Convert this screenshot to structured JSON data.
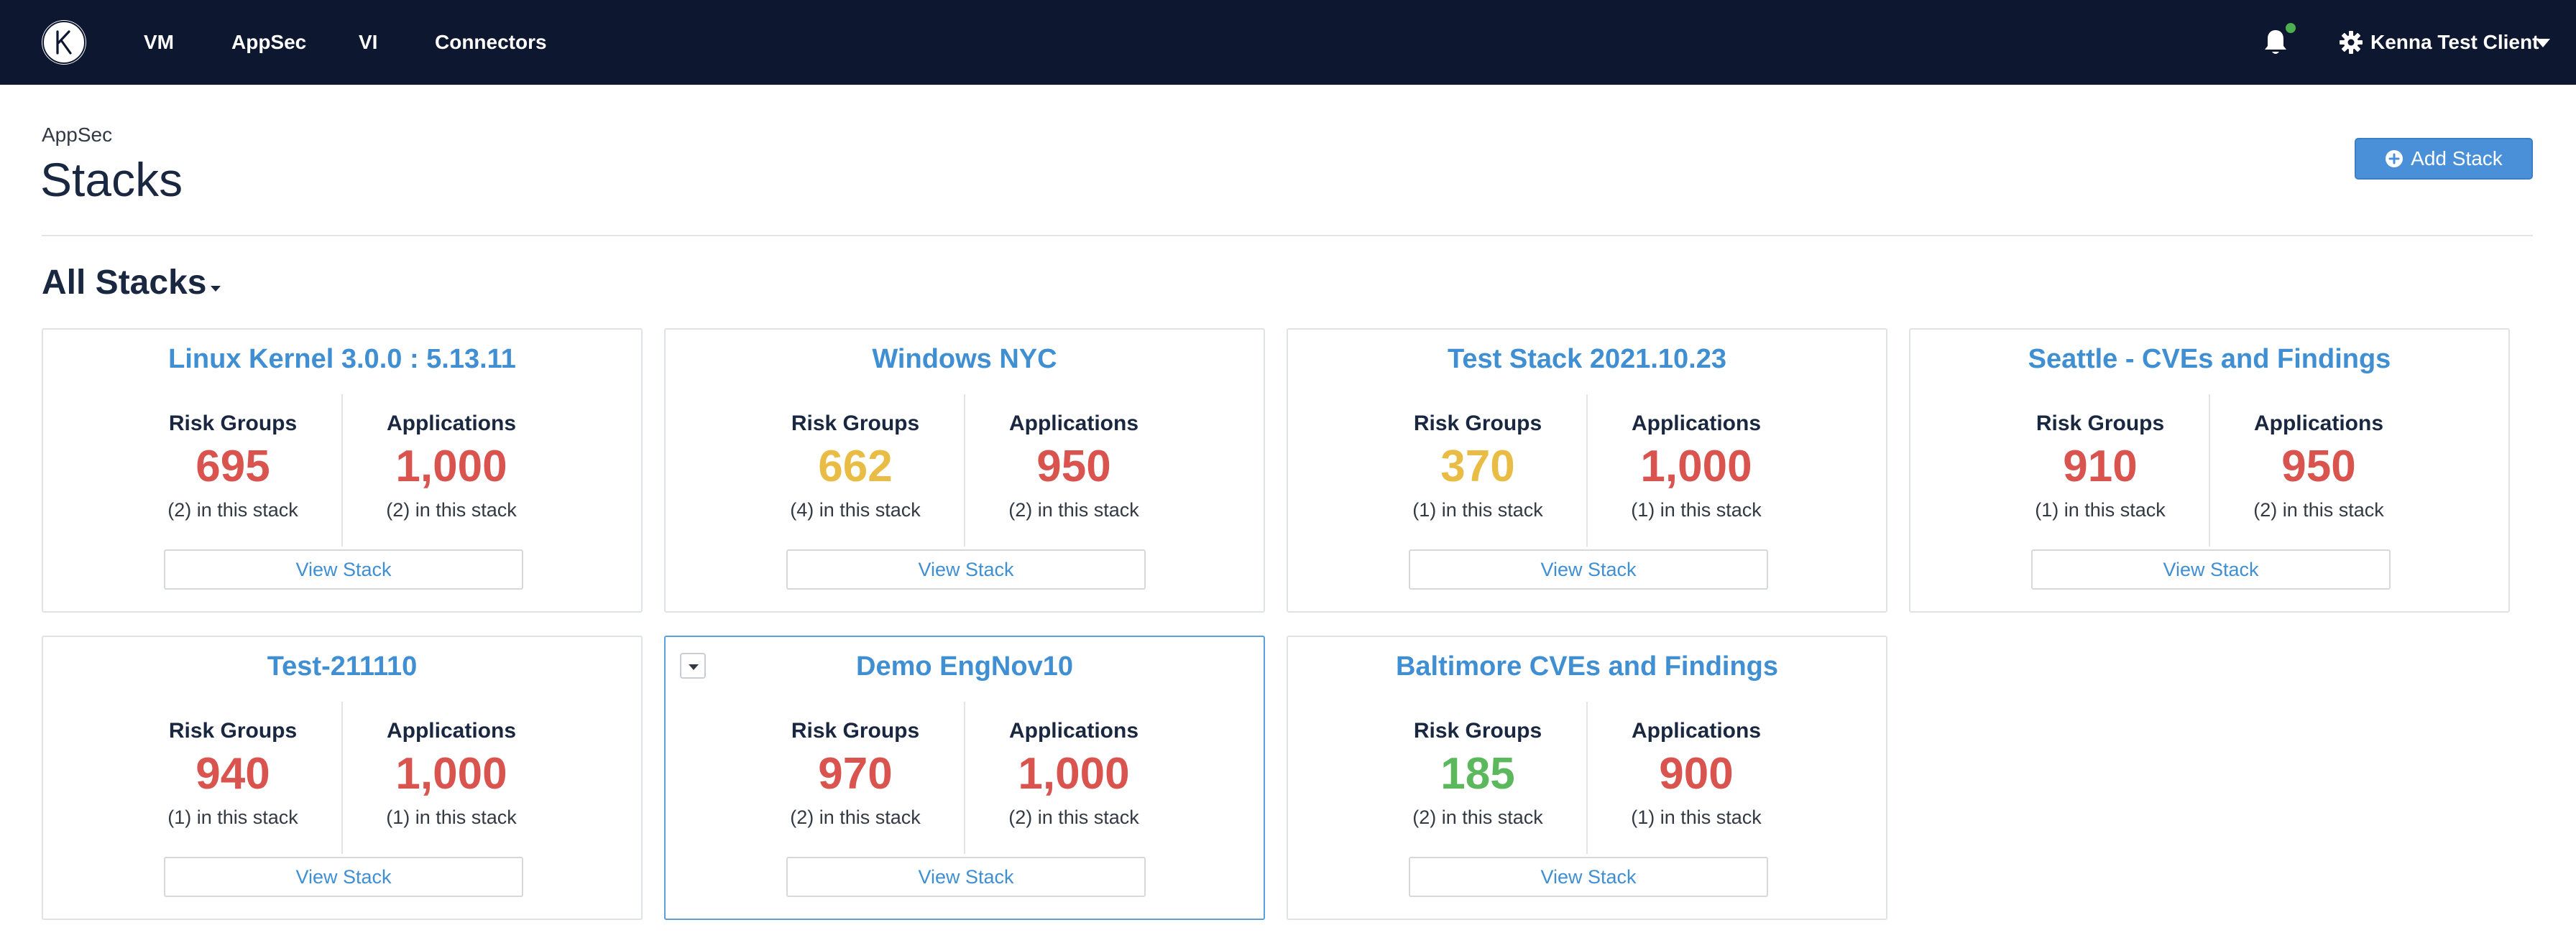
{
  "colors": {
    "nav_bg": "#0e1730",
    "link_blue": "#3f8fd2",
    "risk_red": "#d9534f",
    "risk_yellow": "#e9bd45",
    "risk_green": "#5cb85c",
    "button_blue": "#4a90d9"
  },
  "nav": {
    "logo_letter": "K",
    "items": [
      "VM",
      "AppSec",
      "VI",
      "Connectors"
    ],
    "client_name": "Kenna Test Client",
    "icons": [
      "bell-icon",
      "gear-icon",
      "caret-down-icon"
    ]
  },
  "header": {
    "breadcrumb": "AppSec",
    "title": "Stacks",
    "add_button": "Add Stack"
  },
  "section": {
    "title": "All Stacks"
  },
  "cards": [
    {
      "title": "Linux Kernel 3.0.0 : 5.13.11",
      "risk_groups_label": "Risk Groups",
      "risk_groups": "695",
      "risk_color": "#d9534f",
      "risk_sub": "(2) in this stack",
      "apps_label": "Applications",
      "apps": "1,000",
      "apps_color": "#d9534f",
      "apps_sub": "(2) in this stack",
      "button": "View Stack"
    },
    {
      "title": "Windows NYC",
      "risk_groups_label": "Risk Groups",
      "risk_groups": "662",
      "risk_color": "#e9bd45",
      "risk_sub": "(4) in this stack",
      "apps_label": "Applications",
      "apps": "950",
      "apps_color": "#d9534f",
      "apps_sub": "(2) in this stack",
      "button": "View Stack"
    },
    {
      "title": "Test Stack 2021.10.23",
      "risk_groups_label": "Risk Groups",
      "risk_groups": "370",
      "risk_color": "#e9bd45",
      "risk_sub": "(1) in this stack",
      "apps_label": "Applications",
      "apps": "1,000",
      "apps_color": "#d9534f",
      "apps_sub": "(1) in this stack",
      "button": "View Stack"
    },
    {
      "title": "Seattle - CVEs and Findings",
      "risk_groups_label": "Risk Groups",
      "risk_groups": "910",
      "risk_color": "#d9534f",
      "risk_sub": "(1) in this stack",
      "apps_label": "Applications",
      "apps": "950",
      "apps_color": "#d9534f",
      "apps_sub": "(2) in this stack",
      "button": "View Stack"
    },
    {
      "title": "Test-211110",
      "risk_groups_label": "Risk Groups",
      "risk_groups": "940",
      "risk_color": "#d9534f",
      "risk_sub": "(1) in this stack",
      "apps_label": "Applications",
      "apps": "1,000",
      "apps_color": "#d9534f",
      "apps_sub": "(1) in this stack",
      "button": "View Stack"
    },
    {
      "title": "Demo EngNov10",
      "risk_groups_label": "Risk Groups",
      "risk_groups": "970",
      "risk_color": "#d9534f",
      "risk_sub": "(2) in this stack",
      "apps_label": "Applications",
      "apps": "1,000",
      "apps_color": "#d9534f",
      "apps_sub": "(2) in this stack",
      "button": "View Stack"
    },
    {
      "title": "Baltimore CVEs and Findings",
      "risk_groups_label": "Risk Groups",
      "risk_groups": "185",
      "risk_color": "#5cb85c",
      "risk_sub": "(2) in this stack",
      "apps_label": "Applications",
      "apps": "900",
      "apps_color": "#d9534f",
      "apps_sub": "(1) in this stack",
      "button": "View Stack"
    }
  ]
}
